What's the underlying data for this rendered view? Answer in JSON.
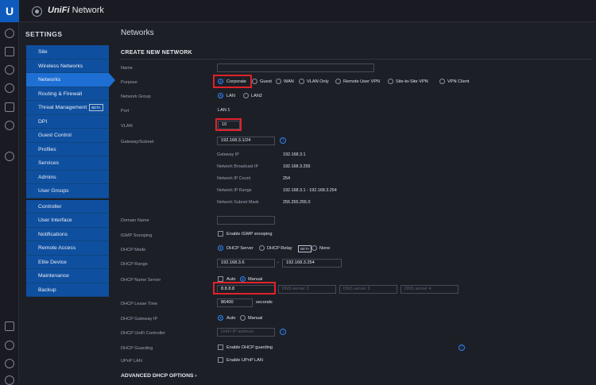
{
  "app": {
    "brand_prefix": "UniFi",
    "brand_suffix": "Network"
  },
  "sidebar": {
    "title": "SETTINGS",
    "group1": [
      "Site",
      "Wireless Networks",
      "Networks",
      "Routing & Firewall",
      "Threat Management",
      "DPI",
      "Guest Control",
      "Profiles",
      "Services",
      "Admins",
      "User Groups"
    ],
    "group2": [
      "Controller",
      "User Interface",
      "Notifications",
      "Remote Access",
      "Elite Device",
      "Maintenance",
      "Backup"
    ],
    "beta": "BETA",
    "active": "Networks"
  },
  "page": {
    "title": "Networks",
    "section": "CREATE NEW NETWORK"
  },
  "form": {
    "name_label": "Name",
    "purpose_label": "Purpose",
    "purpose_options": [
      "Corporate",
      "Guest",
      "WAN",
      "VLAN Only",
      "Remote User VPN",
      "Site-to-Site VPN",
      "VPN Client"
    ],
    "network_group_label": "Network Group",
    "network_group_options": [
      "LAN",
      "LAN2"
    ],
    "port_label": "Port",
    "port_value": "LAN 1",
    "vlan_label": "VLAN",
    "vlan_value": "10",
    "gateway_label": "Gateway/Subnet",
    "gateway_value": "192.168.3.1/24",
    "gateway_ip_label": "Gateway IP",
    "gateway_ip_value": "192.168.3.1",
    "broadcast_label": "Network Broadcast IP",
    "broadcast_value": "192.168.3.255",
    "count_label": "Network IP Count",
    "count_value": "254",
    "range_label": "Network IP Range",
    "range_value": "192.168.3.1 - 192.168.3.254",
    "mask_label": "Network Subnet Mask",
    "mask_value": "255.255.255.0",
    "domain_label": "Domain Name",
    "igmp_label": "IGMP Snooping",
    "igmp_option": "Enable IGMP snooping",
    "dhcp_mode_label": "DHCP Mode",
    "dhcp_mode_options": [
      "DHCP Server",
      "DHCP Relay",
      "None"
    ],
    "dhcp_range_label": "DHCP Range",
    "dhcp_range_start": "192.168.3.6",
    "dhcp_range_dash": "-",
    "dhcp_range_end": "192.168.3.254",
    "dns_label": "DHCP Name Server",
    "dns_options": [
      "Auto",
      "Manual"
    ],
    "dns1": "8.8.8.8",
    "dns2_ph": "DNS server 2",
    "dns3_ph": "DNS server 3",
    "dns4_ph": "DNS server 4",
    "lease_label": "DHCP Lease Time",
    "lease_value": "86400",
    "lease_unit": "seconds",
    "gw_label": "DHCP Gateway IP",
    "gw_options": [
      "Auto",
      "Manual"
    ],
    "unifi_label": "DHCP UniFi Controller",
    "unifi_ph": "UniFi IP address",
    "guard_label": "DHCP Guarding",
    "guard_option": "Enable DHCP guarding",
    "upnp_label": "UPnP LAN",
    "upnp_option": "Enable UPnP LAN",
    "advanced": "ADVANCED DHCP OPTIONS"
  },
  "colors": {
    "accent": "#2f84f2",
    "sidebar": "#0f4f9f",
    "highlight": "#e0222a"
  }
}
